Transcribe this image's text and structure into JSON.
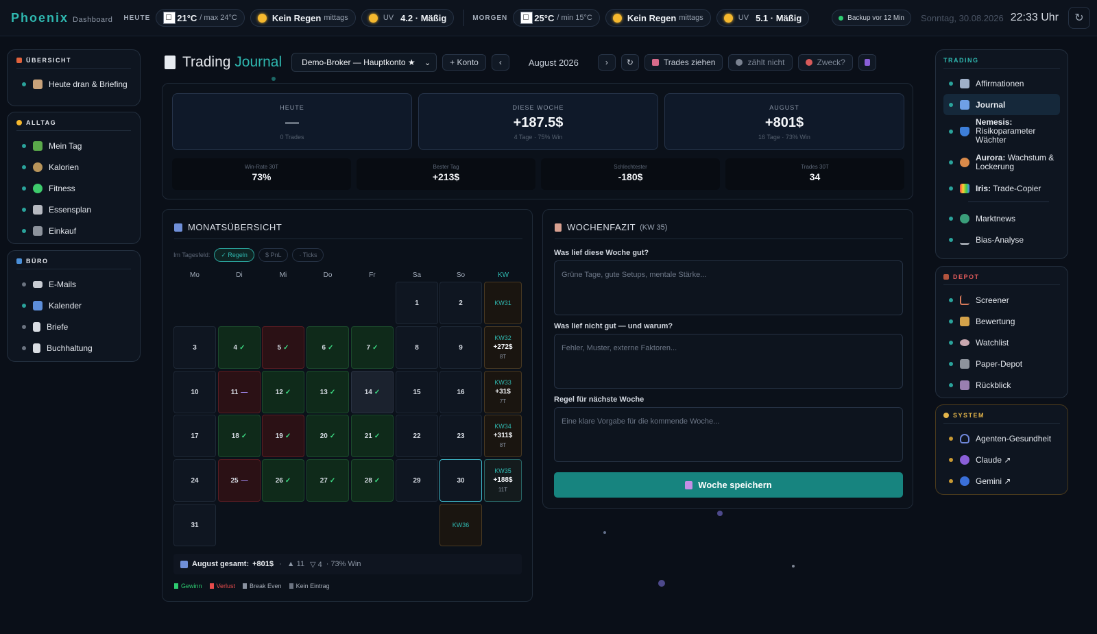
{
  "app": {
    "name": "Phoenix",
    "subtitle": "Dashboard"
  },
  "weather": {
    "today_label": "HEUTE",
    "today_temp": "21°C",
    "today_max": "/ max 24°C",
    "today_rain": "Kein Regen",
    "today_rain_sub": "mittags",
    "today_uv_label": "UV",
    "today_uv": "4.2 · Mäßig",
    "tomorrow_label": "MORGEN",
    "tomorrow_temp": "25°C",
    "tomorrow_min": "/ min 15°C",
    "tomorrow_rain": "Kein Regen",
    "tomorrow_rain_sub": "mittags",
    "tomorrow_uv_label": "UV",
    "tomorrow_uv": "5.1 · Mäßig"
  },
  "status": {
    "backup": "Backup vor 12 Min",
    "date": "Sonntag, 30.08.2026",
    "time": "22:33 Uhr",
    "refresh_icon": "↻"
  },
  "left_sidebar": {
    "overview": {
      "title": "ÜBERSICHT",
      "items": [
        {
          "label": "Heute dran & Briefing"
        }
      ]
    },
    "alltag": {
      "title": "ALLTAG",
      "items": [
        {
          "label": "Mein Tag"
        },
        {
          "label": "Kalorien"
        },
        {
          "label": "Fitness"
        },
        {
          "label": "Essensplan"
        },
        {
          "label": "Einkauf"
        }
      ]
    },
    "buero": {
      "title": "BÜRO",
      "items": [
        {
          "label": "E-Mails"
        },
        {
          "label": "Kalender"
        },
        {
          "label": "Briefe"
        },
        {
          "label": "Buchhaltung"
        }
      ]
    }
  },
  "right_sidebar": {
    "trading": {
      "title": "TRADING",
      "items": [
        {
          "label": "Affirmationen"
        },
        {
          "label": "Journal"
        },
        {
          "bold": "Nemesis:",
          "label": "Risikoparameter Wächter"
        },
        {
          "bold": "Aurora:",
          "label": "Wachstum & Lockerung"
        },
        {
          "bold": "Iris:",
          "label": "Trade-Copier"
        },
        {
          "label": "Marktnews"
        },
        {
          "label": "Bias-Analyse"
        }
      ]
    },
    "depot": {
      "title": "DEPOT",
      "items": [
        {
          "label": "Screener"
        },
        {
          "label": "Bewertung"
        },
        {
          "label": "Watchlist"
        },
        {
          "label": "Paper-Depot"
        },
        {
          "label": "Rückblick"
        }
      ]
    },
    "system": {
      "title": "SYSTEM",
      "items": [
        {
          "label": "Agenten-Gesundheit"
        },
        {
          "label": "Claude ↗"
        },
        {
          "label": "Gemini ↗"
        }
      ]
    }
  },
  "header": {
    "title_a": "Trading ",
    "title_b": "Journal",
    "account": "Demo-Broker — Hauptkonto ★",
    "add_account": "+ Konto",
    "prev": "‹",
    "month": "August 2026",
    "next": "›",
    "reload": "↻",
    "pull_trades": "Trades ziehen",
    "not_counting": "zählt nicht",
    "purpose": "Zweck?"
  },
  "stats": {
    "today": {
      "label": "HEUTE",
      "value": "—",
      "sub": "0 Trades"
    },
    "week": {
      "label": "DIESE WOCHE",
      "value": "+187.5$",
      "sub": "4 Tage · 75% Win"
    },
    "month": {
      "label": "AUGUST",
      "value": "+801$",
      "sub": "16 Tage · 73% Win"
    },
    "winrate": {
      "label": "Win-Rate 30T",
      "value": "73%"
    },
    "best": {
      "label": "Bester Tag",
      "value": "+213$"
    },
    "worst": {
      "label": "Schlechtester",
      "value": "-180$"
    },
    "trades": {
      "label": "Trades 30T",
      "value": "34"
    }
  },
  "calendar": {
    "title": "MONATSÜBERSICHT",
    "filter_label": "Im Tagesfeld:",
    "filters": [
      "✓ Regeln",
      "$ PnL",
      "· Ticks"
    ],
    "weekdays": [
      "Mo",
      "Di",
      "Mi",
      "Do",
      "Fr",
      "Sa",
      "So",
      "KW"
    ],
    "days": [
      {
        "d": "1",
        "col": 5,
        "row": 0,
        "s": "n",
        "m": ""
      },
      {
        "d": "2",
        "col": 6,
        "row": 0,
        "s": "n",
        "m": ""
      },
      {
        "d": "3",
        "col": 0,
        "row": 1,
        "s": "n",
        "m": ""
      },
      {
        "d": "4",
        "col": 1,
        "row": 1,
        "s": "g",
        "m": "✓"
      },
      {
        "d": "5",
        "col": 2,
        "row": 1,
        "s": "r",
        "m": "✓"
      },
      {
        "d": "6",
        "col": 3,
        "row": 1,
        "s": "g",
        "m": "✓"
      },
      {
        "d": "7",
        "col": 4,
        "row": 1,
        "s": "g",
        "m": "✓"
      },
      {
        "d": "8",
        "col": 5,
        "row": 1,
        "s": "n",
        "m": ""
      },
      {
        "d": "9",
        "col": 6,
        "row": 1,
        "s": "n",
        "m": ""
      },
      {
        "d": "10",
        "col": 0,
        "row": 2,
        "s": "n",
        "m": ""
      },
      {
        "d": "11",
        "col": 1,
        "row": 2,
        "s": "r",
        "m": "—"
      },
      {
        "d": "12",
        "col": 2,
        "row": 2,
        "s": "g",
        "m": "✓"
      },
      {
        "d": "13",
        "col": 3,
        "row": 2,
        "s": "g",
        "m": "✓"
      },
      {
        "d": "14",
        "col": 4,
        "row": 2,
        "s": "b",
        "m": "✓"
      },
      {
        "d": "15",
        "col": 5,
        "row": 2,
        "s": "n",
        "m": ""
      },
      {
        "d": "16",
        "col": 6,
        "row": 2,
        "s": "n",
        "m": ""
      },
      {
        "d": "17",
        "col": 0,
        "row": 3,
        "s": "n",
        "m": ""
      },
      {
        "d": "18",
        "col": 1,
        "row": 3,
        "s": "g",
        "m": "✓"
      },
      {
        "d": "19",
        "col": 2,
        "row": 3,
        "s": "r",
        "m": "✓"
      },
      {
        "d": "20",
        "col": 3,
        "row": 3,
        "s": "g",
        "m": "✓"
      },
      {
        "d": "21",
        "col": 4,
        "row": 3,
        "s": "g",
        "m": "✓"
      },
      {
        "d": "22",
        "col": 5,
        "row": 3,
        "s": "n",
        "m": ""
      },
      {
        "d": "23",
        "col": 6,
        "row": 3,
        "s": "n",
        "m": ""
      },
      {
        "d": "24",
        "col": 0,
        "row": 4,
        "s": "n",
        "m": ""
      },
      {
        "d": "25",
        "col": 1,
        "row": 4,
        "s": "r",
        "m": "—"
      },
      {
        "d": "26",
        "col": 2,
        "row": 4,
        "s": "g",
        "m": "✓"
      },
      {
        "d": "27",
        "col": 3,
        "row": 4,
        "s": "g",
        "m": "✓"
      },
      {
        "d": "28",
        "col": 4,
        "row": 4,
        "s": "g",
        "m": "✓"
      },
      {
        "d": "29",
        "col": 5,
        "row": 4,
        "s": "n",
        "m": ""
      },
      {
        "d": "30",
        "col": 6,
        "row": 4,
        "s": "today",
        "m": ""
      },
      {
        "d": "31",
        "col": 0,
        "row": 5,
        "s": "n",
        "m": ""
      }
    ],
    "weeks": [
      {
        "kw": "KW31",
        "pnl": "",
        "trades": "",
        "row": 0,
        "col": 7
      },
      {
        "kw": "KW32",
        "pnl": "+272$",
        "trades": "8T",
        "row": 1,
        "col": 7
      },
      {
        "kw": "KW33",
        "pnl": "+31$",
        "trades": "7T",
        "row": 2,
        "col": 7
      },
      {
        "kw": "KW34",
        "pnl": "+311$",
        "trades": "8T",
        "row": 3,
        "col": 7
      },
      {
        "kw": "KW35",
        "pnl": "+188$",
        "trades": "11T",
        "row": 4,
        "col": 7,
        "current": true
      },
      {
        "kw": "KW36",
        "pnl": "",
        "trades": "",
        "row": 5,
        "col": 6
      }
    ],
    "summary": {
      "label": "August gesamt:",
      "value": "+801$",
      "sep": "·",
      "up": "▲ 11",
      "down": "▽ 4",
      "win": "· 73% Win"
    },
    "legend": [
      {
        "label": "Gewinn",
        "color": "#2ecc71"
      },
      {
        "label": "Verlust",
        "color": "#e74c4c"
      },
      {
        "label": "Break Even",
        "color": "#8a92a0"
      },
      {
        "label": "Kein Eintrag",
        "color": "#6b7380"
      }
    ]
  },
  "weekly": {
    "title": "WOCHENFAZIT",
    "kw": "(KW 35)",
    "q1": "Was lief diese Woche gut?",
    "p1": "Grüne Tage, gute Setups, mentale Stärke...",
    "q2": "Was lief nicht gut — und warum?",
    "p2": "Fehler, Muster, externe Faktoren...",
    "q3": "Regel für nächste Woche",
    "p3": "Eine klare Vorgabe für die kommende Woche...",
    "save": "Woche speichern"
  },
  "colors": {
    "accent": "#2fb8b0",
    "gain": "#2ecc71",
    "loss": "#e74c4c",
    "save": "#17847f"
  }
}
